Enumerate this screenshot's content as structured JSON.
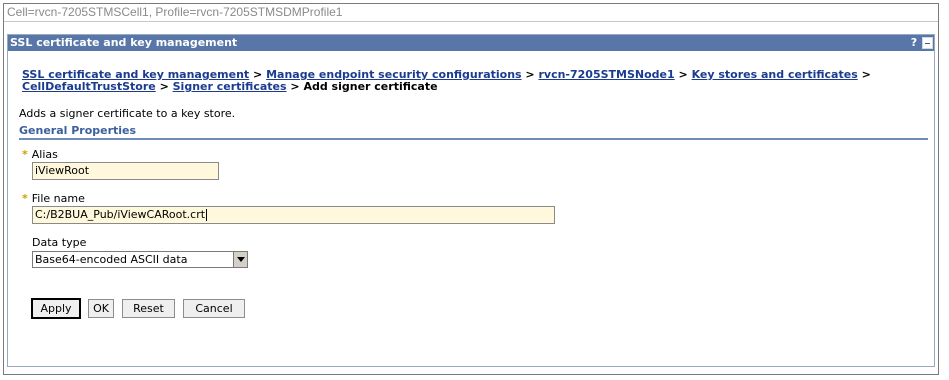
{
  "cell_bar": {
    "text": "Cell=rvcn-7205STMSCell1, Profile=rvcn-7205STMSDMProfile1"
  },
  "panel": {
    "title": "SSL certificate and key management",
    "help_label": "?"
  },
  "breadcrumb": {
    "links": [
      "SSL certificate and key management",
      "Manage endpoint security configurations",
      "rvcn-7205STMSNode1",
      "Key stores and certificates",
      "CellDefaultTrustStore",
      "Signer certificates"
    ],
    "separator": ">",
    "current": "Add signer certificate"
  },
  "description": "Adds a signer certificate to a key store.",
  "general_properties": {
    "title": "General Properties",
    "required_marker": "*",
    "alias": {
      "label": "Alias",
      "value": "iViewRoot"
    },
    "file_name": {
      "label": "File name",
      "value": "C:/B2BUA_Pub/iViewCARoot.crt"
    },
    "data_type": {
      "label": "Data type",
      "selected": "Base64-encoded ASCII data"
    }
  },
  "buttons": {
    "apply": "Apply",
    "ok": "OK",
    "reset": "Reset",
    "cancel": "Cancel"
  },
  "colors": {
    "title_bar": "#5876a7",
    "link": "#1a3b8f",
    "section_title": "#3a5f9e",
    "input_background": "#fff8dc",
    "required_marker": "#c9a300"
  }
}
